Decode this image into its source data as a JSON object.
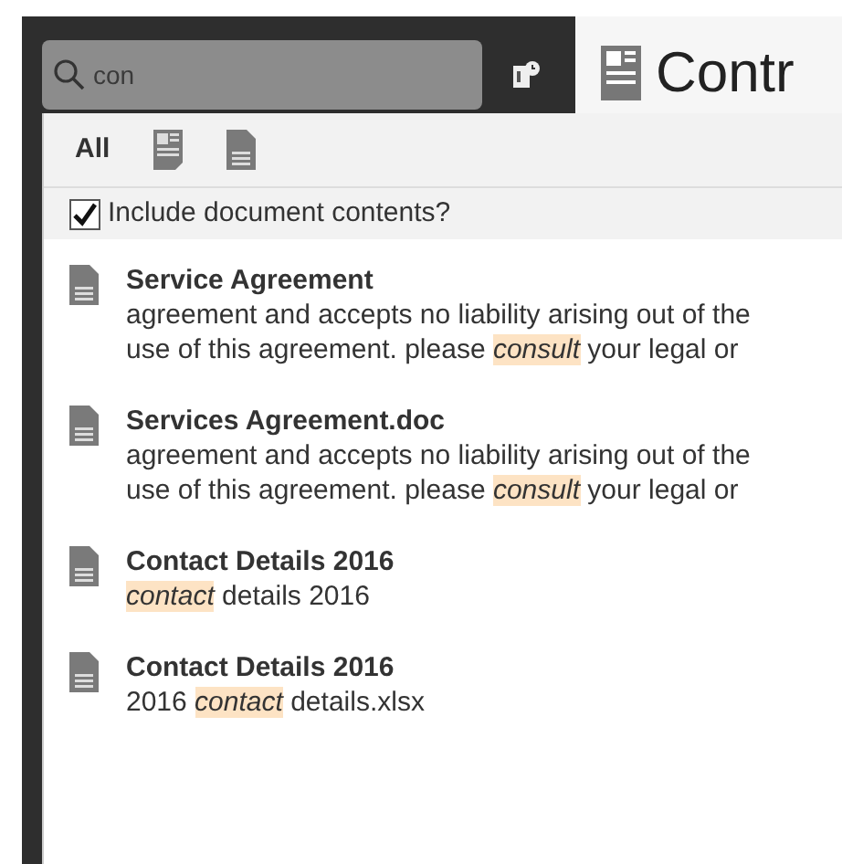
{
  "search": {
    "value": "con"
  },
  "header": {
    "title": "Contr"
  },
  "filters": [
    {
      "kind": "text",
      "label": "All"
    },
    {
      "kind": "layout-doc"
    },
    {
      "kind": "plain-doc"
    }
  ],
  "include_contents": {
    "label": "Include document contents?",
    "checked": true
  },
  "results": [
    {
      "title": "Service Agreement",
      "snippet": "agreement and accepts no liability arising out of the use of this agreement. please *consult* your legal or"
    },
    {
      "title": "Services Agreement.doc",
      "snippet": "agreement and accepts no liability arising out of the use of this agreement. please *consult* your legal or"
    },
    {
      "title": "Contact Details 2016",
      "snippet": "*contact* details 2016"
    },
    {
      "title": "Contact Details 2016",
      "snippet": "2016 *contact* details.xlsx"
    }
  ]
}
